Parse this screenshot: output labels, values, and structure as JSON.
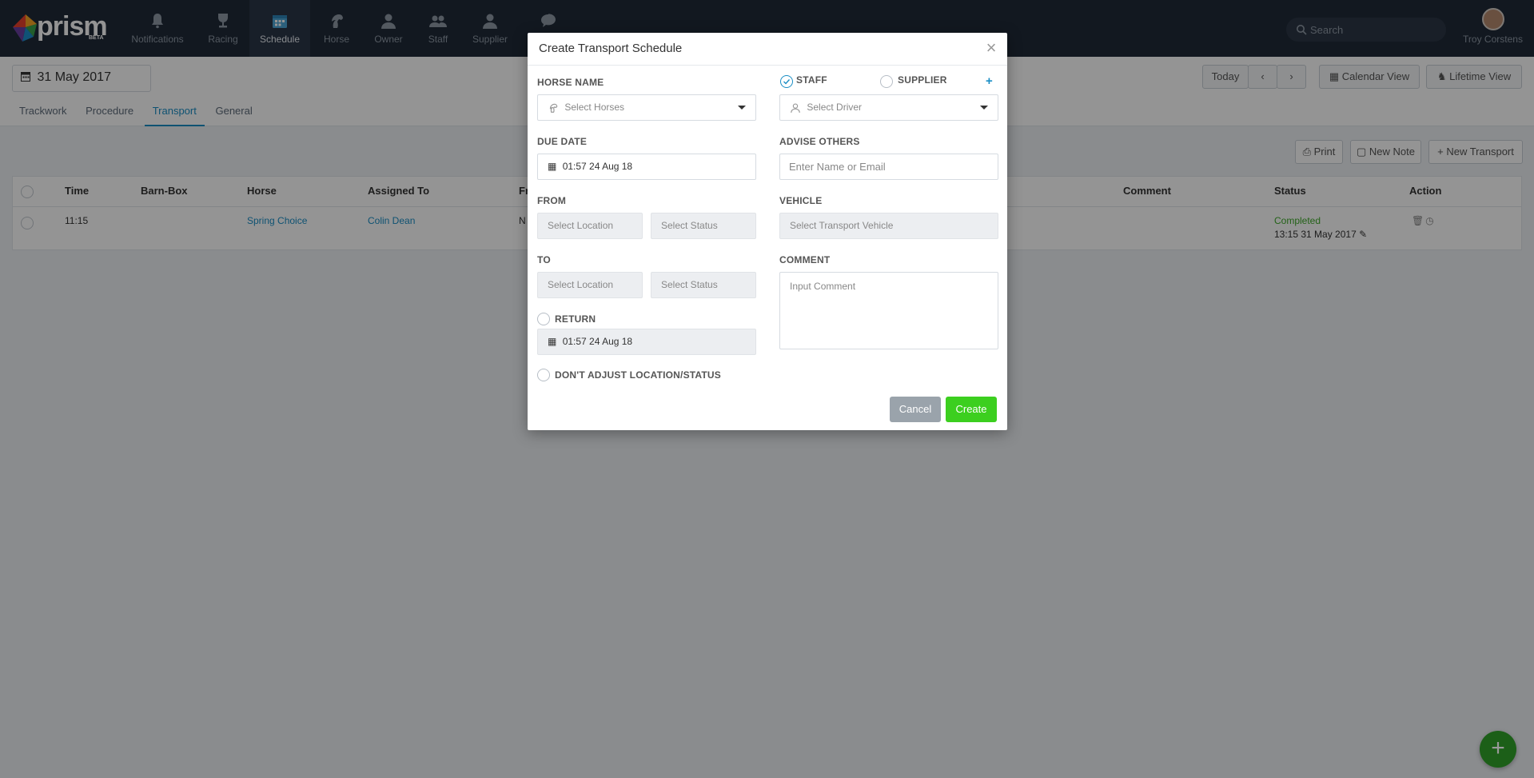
{
  "app": {
    "logo_text": "prism",
    "logo_badge": "BETA"
  },
  "nav": {
    "items": [
      {
        "label": "Notifications",
        "icon": "bell-icon"
      },
      {
        "label": "Racing",
        "icon": "trophy-icon"
      },
      {
        "label": "Schedule",
        "icon": "calendar-icon",
        "active": true
      },
      {
        "label": "Horse",
        "icon": "horse-head-icon"
      },
      {
        "label": "Owner",
        "icon": "user-icon"
      },
      {
        "label": "Staff",
        "icon": "users-icon"
      },
      {
        "label": "Supplier",
        "icon": "user-icon"
      },
      {
        "label": "",
        "icon": "chat-icon"
      },
      {
        "label": "",
        "icon": "cards-icon"
      },
      {
        "label": "",
        "icon": "gear-icon"
      },
      {
        "label": "",
        "icon": "dollar-icon"
      }
    ],
    "search_placeholder": "Search",
    "user_name": "Troy Corstens"
  },
  "subheader": {
    "date": "31 May 2017",
    "tabs": [
      "Trackwork",
      "Procedure",
      "Transport",
      "General"
    ],
    "active_tab": "Transport",
    "today_label": "Today",
    "calendar_view_label": "Calendar View",
    "lifetime_view_label": "Lifetime View"
  },
  "actions": {
    "print_label": "Print",
    "new_note_label": "New Note",
    "new_transport_label": "New Transport"
  },
  "table": {
    "headers": [
      "Time",
      "Barn-Box",
      "Horse",
      "Assigned To",
      "Fr",
      "Comment",
      "Status",
      "Action"
    ],
    "rows": [
      {
        "time": "11:15",
        "barn_box": "",
        "horse": "Spring Choice",
        "assigned_to": "Colin Dean",
        "from": "N",
        "comment": "",
        "status": "Completed",
        "status_time": "13:15 31 May 2017"
      }
    ]
  },
  "modal": {
    "title": "Create Transport Schedule",
    "close_symbol": "×",
    "horse_name_label": "HORSE NAME",
    "horse_placeholder": "Select Horses",
    "staff_label": "STAFF",
    "supplier_label": "SUPPLIER",
    "add_symbol": "+",
    "driver_placeholder": "Select Driver",
    "due_date_label": "DUE DATE",
    "due_date_value": "01:57 24 Aug 18",
    "advise_others_label": "ADVISE OTHERS",
    "advise_placeholder": "Enter Name or Email",
    "from_label": "FROM",
    "location_placeholder": "Select Location",
    "status_placeholder": "Select Status",
    "vehicle_label": "VEHICLE",
    "vehicle_placeholder": "Select Transport Vehicle",
    "to_label": "TO",
    "comment_label": "COMMENT",
    "comment_placeholder": "Input Comment",
    "return_label": "RETURN",
    "return_date_value": "01:57 24 Aug 18",
    "dont_adjust_label": "DON'T ADJUST LOCATION/STATUS",
    "cancel_label": "Cancel",
    "create_label": "Create"
  },
  "colors": {
    "nav_bg": "#1f2a38",
    "accent": "#1a8ec5",
    "success": "#3eaa2a",
    "create_button": "#3ccf1f",
    "cancel_button": "#9aa3ab"
  }
}
